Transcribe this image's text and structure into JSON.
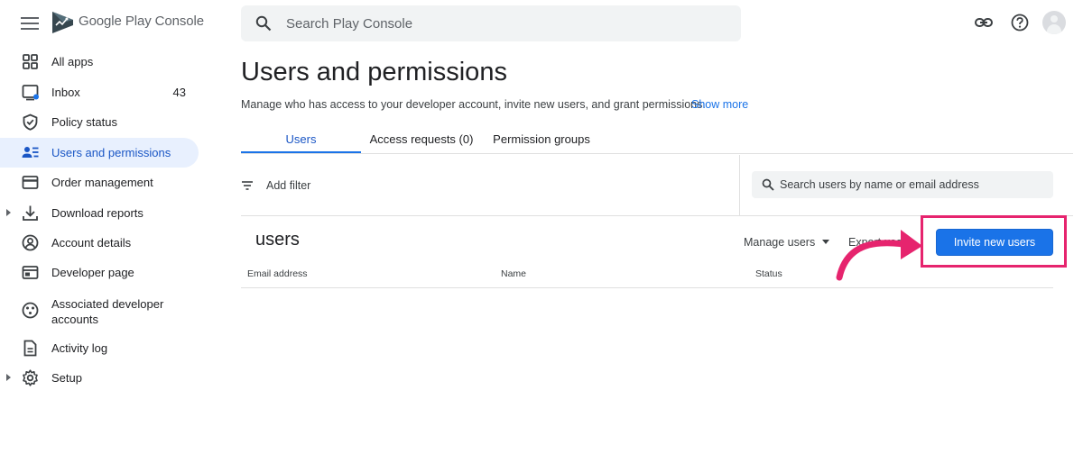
{
  "app": {
    "brand": "Google Play Console"
  },
  "search": {
    "placeholder": "Search Play Console"
  },
  "topbar": {
    "icons": [
      "link-icon",
      "help-icon",
      "account-avatar"
    ]
  },
  "sidebar": {
    "items": [
      {
        "label": "All apps",
        "icon": "grid-icon"
      },
      {
        "label": "Inbox",
        "icon": "inbox-icon",
        "count": "43"
      },
      {
        "label": "Policy status",
        "icon": "shield-icon"
      },
      {
        "label": "Users and permissions",
        "icon": "users-list-icon",
        "active": true
      },
      {
        "label": "Order management",
        "icon": "credit-card-icon"
      },
      {
        "label": "Download reports",
        "icon": "download-icon",
        "expandable": true
      },
      {
        "label": "Account details",
        "icon": "account-circle-icon"
      },
      {
        "label": "Developer page",
        "icon": "web-page-icon"
      },
      {
        "label": "Associated developer accounts",
        "icon": "linked-accounts-icon"
      },
      {
        "label": "Activity log",
        "icon": "document-icon"
      },
      {
        "label": "Setup",
        "icon": "gear-icon",
        "expandable": true
      }
    ]
  },
  "main": {
    "title": "Users and permissions",
    "description": "Manage who has access to your developer account, invite new users, and grant permissions.",
    "show_more": "Show more",
    "tabs": [
      {
        "label": "Users",
        "active": true
      },
      {
        "label": "Access requests (0)"
      },
      {
        "label": "Permission groups"
      }
    ],
    "filter_label": "Add filter",
    "user_search_placeholder": "Search users by name or email address",
    "section_title": "users",
    "manage_users": "Manage users",
    "export_users": "Export users",
    "invite_button": "Invite new users",
    "table": {
      "columns": [
        "Email address",
        "Name",
        "Status"
      ]
    }
  },
  "colors": {
    "accent": "#1a73e8",
    "active_nav_bg": "#e8f0fe",
    "annotation": "#e6246e"
  }
}
